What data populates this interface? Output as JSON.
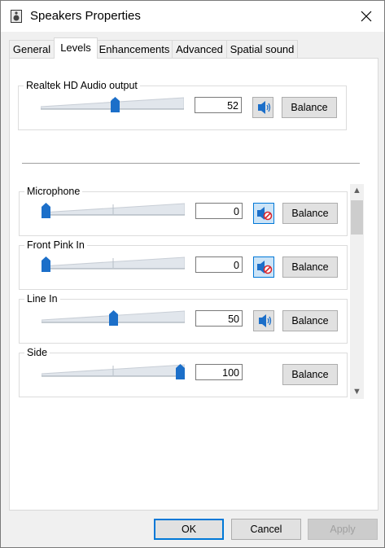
{
  "window": {
    "title": "Speakers Properties"
  },
  "tabs": [
    "General",
    "Levels",
    "Enhancements",
    "Advanced",
    "Spatial sound"
  ],
  "active_tab": "Levels",
  "master": {
    "label": "Realtek HD Audio output",
    "value": "52",
    "level": 0.52,
    "muted": false,
    "balance_label": "Balance"
  },
  "channels": [
    {
      "label": "Microphone",
      "value": "0",
      "level": 0.0,
      "muted": true,
      "has_mute": true,
      "balance_label": "Balance"
    },
    {
      "label": "Front Pink In",
      "value": "0",
      "level": 0.0,
      "muted": true,
      "has_mute": true,
      "balance_label": "Balance"
    },
    {
      "label": "Line In",
      "value": "50",
      "level": 0.5,
      "muted": false,
      "has_mute": true,
      "balance_label": "Balance"
    },
    {
      "label": "Side",
      "value": "100",
      "level": 1.0,
      "muted": false,
      "has_mute": false,
      "balance_label": "Balance"
    }
  ],
  "buttons": {
    "ok": "OK",
    "cancel": "Cancel",
    "apply": "Apply"
  },
  "colors": {
    "accent": "#0078d7",
    "thumb": "#1c6fc9",
    "track": "#d6dce4"
  },
  "icons": {
    "app": "speaker-properties-icon",
    "close": "close-icon",
    "speaker": "speaker-icon",
    "muted_speaker": "speaker-muted-icon"
  }
}
